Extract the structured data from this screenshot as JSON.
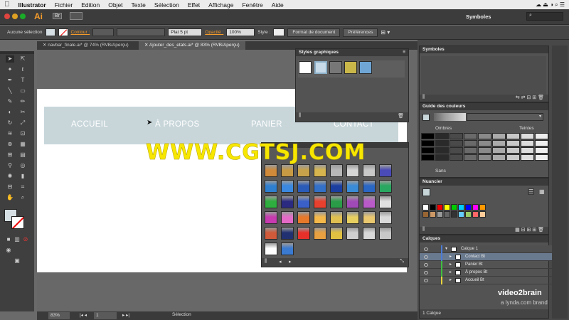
{
  "menu": {
    "apple_icon": "apple-icon",
    "app_name": "Illustrator",
    "items": [
      "Fichier",
      "Edition",
      "Objet",
      "Texte",
      "Sélection",
      "Effet",
      "Affichage",
      "Fenêtre",
      "Aide"
    ]
  },
  "appbar": {
    "logo": "Ai",
    "br": "Br",
    "workspace": "Symboles"
  },
  "control": {
    "selection_label": "Aucune sélection",
    "contour_label": "Contour :",
    "stroke_profile": "Plat 5 pt",
    "opacity_label": "Opacité :",
    "opacity_value": "100%",
    "style_label": "Style :",
    "doc_format_btn": "Format de document",
    "prefs_btn": "Préférences"
  },
  "tabs": [
    {
      "label": "navbar_finale.ai* @ 74% (RVB/Aperçu)"
    },
    {
      "label": "Ajouter_des_etats.ai* @ 83% (RVB/Aperçu)"
    }
  ],
  "artboard": {
    "nav_items": [
      "ACCUEIL",
      "À PROPOS",
      "PANIER",
      "CONTACT"
    ]
  },
  "status": {
    "zoom": "83%",
    "page": "1",
    "mode": "Sélection"
  },
  "panels": {
    "graphic_styles_title": "Styles graphiques",
    "symbols_title": "Symboles",
    "color_guide_title": "Guide des couleurs",
    "shades_label": "Ombres",
    "tints_label": "Teintes",
    "sans_label": "Sans",
    "swatches_title": "Nuancier",
    "layers_title": "Calques",
    "layers_count": "1 Calque"
  },
  "layers": [
    {
      "name": "Calque 1",
      "color": "#4a7bd6"
    },
    {
      "name": "Contact Bt",
      "color": "#4a7bd6"
    },
    {
      "name": "Panier Bt",
      "color": "#3fbf3f"
    },
    {
      "name": "À propos Bt",
      "color": "#3fbf3f"
    },
    {
      "name": "Accueil Bt",
      "color": "#e8d43a"
    }
  ],
  "overlay": {
    "watermark": "WWW.CGTSJ.COM",
    "brand": "video2brain",
    "brand_sub": "a lynda.com brand"
  },
  "colors": {
    "accent_orange": "#f39a2b",
    "nav_bg": "#c8d6da",
    "watermark": "#f7e700"
  }
}
